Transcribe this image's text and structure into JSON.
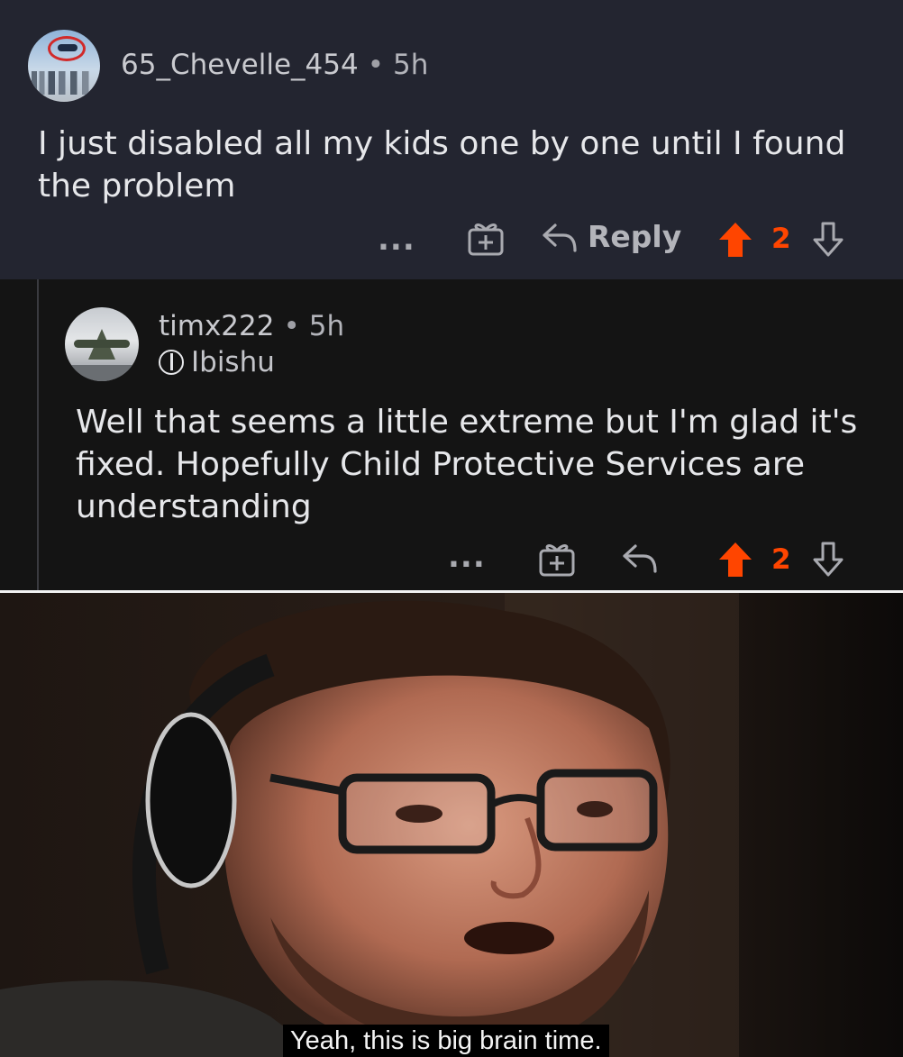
{
  "comments": [
    {
      "author": "65_Chevelle_454",
      "time": "5h",
      "body_lines": [
        "I just disabled all my kids one by one until I found",
        "the problem"
      ],
      "actions": {
        "more": "...",
        "reply": "Reply",
        "votes": "2"
      },
      "avatar_icon": "chevelle-car-avatar"
    },
    {
      "author": "timx222",
      "time": "5h",
      "flair": "Ibishu",
      "body_lines": [
        "Well that seems a little extreme but I'm glad it's",
        "fixed. Hopefully Child Protective Services are",
        "understanding"
      ],
      "actions": {
        "more": "...",
        "votes": "2"
      },
      "avatar_icon": "jet-fighter-avatar"
    }
  ],
  "meme": {
    "caption": "Yeah, this is big brain time.",
    "subject": "man-with-headphones-and-glasses"
  },
  "colors": {
    "top_panel_bg": "#232530",
    "reply_panel_bg": "#141414",
    "upvote_accent": "#ff4500",
    "text_primary": "#e6e7ea",
    "text_secondary": "#b3b4ba"
  }
}
